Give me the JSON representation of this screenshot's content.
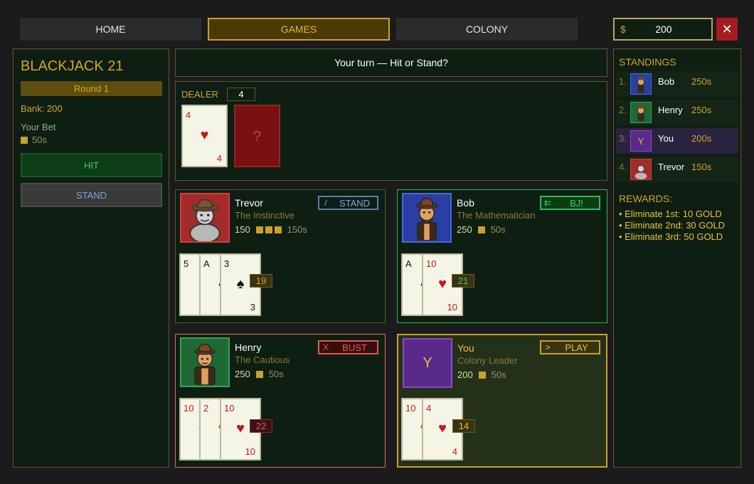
{
  "nav": {
    "home": "HOME",
    "games": "GAMES",
    "colony": "COLONY",
    "currency_symbol": "$",
    "money": "200",
    "close": "✕"
  },
  "sidebar": {
    "title": "BLACKJACK 21",
    "round": "Round 1",
    "bank": "Bank: 200",
    "bet_label": "Your Bet",
    "bet_value": "50s",
    "hit": "HIT",
    "stand": "STAND"
  },
  "message": "Your turn — Hit or Stand?",
  "dealer": {
    "label": "DEALER",
    "total": "4",
    "cards": [
      {
        "rank": "4",
        "suit": "♥",
        "bottom": "4",
        "color": "#c21818"
      },
      {
        "hidden": "?"
      }
    ]
  },
  "seats": {
    "trevor": {
      "name": "Trevor",
      "title": "The Instinctive",
      "coins": "150",
      "bet": "150s",
      "bet_chips": 3,
      "status_icon": "/",
      "status": "STAND",
      "total": "19",
      "icon": "cowboy-avatar",
      "cards": [
        {
          "rank": "5",
          "suit": "♠"
        },
        {
          "rank": "A",
          "suit": "♠"
        },
        {
          "rank": "3",
          "suit": "♠",
          "bottom": "3"
        }
      ]
    },
    "bob": {
      "name": "Bob",
      "title": "The Mathematician",
      "coins": "250",
      "bet": "50s",
      "bet_chips": 1,
      "status_icon": "⇇",
      "status": "BJ!",
      "total": "21",
      "icon": "bearded-avatar",
      "cards": [
        {
          "rank": "A",
          "suit": "♠"
        },
        {
          "rank": "10",
          "suit": "♥",
          "bottom": "10"
        }
      ]
    },
    "henry": {
      "name": "Henry",
      "title": "The Cautious",
      "coins": "250",
      "bet": "50s",
      "bet_chips": 1,
      "status_icon": "X",
      "status": "BUST",
      "total": "22",
      "icon": "hatted-avatar",
      "cards": [
        {
          "rank": "10",
          "suit": "♥"
        },
        {
          "rank": "2",
          "suit": "♥"
        },
        {
          "rank": "10",
          "suit": "♥",
          "bottom": "10"
        }
      ]
    },
    "you": {
      "name": "You",
      "title": "Colony Leader",
      "coins": "200",
      "bet": "50s",
      "bet_chips": 1,
      "avatar_letter": "Y",
      "status_icon": ">",
      "status": "PLAY",
      "total": "14",
      "cards": [
        {
          "rank": "10",
          "suit": "♥"
        },
        {
          "rank": "4",
          "suit": "♥",
          "bottom": "4"
        }
      ]
    }
  },
  "standings": {
    "title": "STANDINGS",
    "rows": [
      {
        "rank": "1.",
        "name": "Bob",
        "score": "250s"
      },
      {
        "rank": "2.",
        "name": "Henry",
        "score": "250s"
      },
      {
        "rank": "3.",
        "name": "You",
        "score": "200s",
        "letter": "Y"
      },
      {
        "rank": "4.",
        "name": "Trevor",
        "score": "150s"
      }
    ]
  },
  "rewards": {
    "title": "REWARDS:",
    "items": [
      "• Eliminate 1st: 10 GOLD",
      "• Eliminate 2nd: 30 GOLD",
      "• Eliminate 3rd: 50 GOLD"
    ]
  },
  "colors": {
    "gold": "#d4a52a",
    "red_suit": "#c21818",
    "stand": "#7aa6e0",
    "bj": "#3ad05a",
    "bust": "#e05a5a",
    "play": "#e6c23a"
  }
}
